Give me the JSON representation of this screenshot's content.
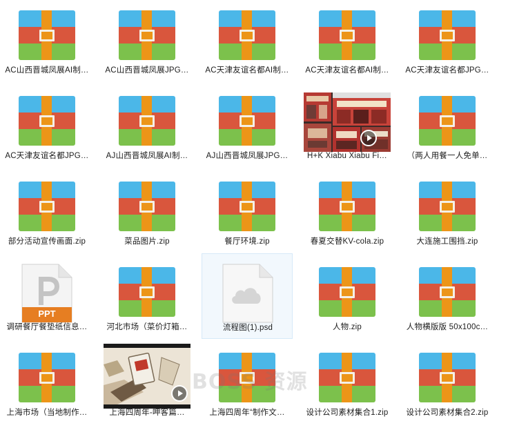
{
  "watermark": "BOSS 资源",
  "colors": {
    "zip_blue": "#4bb7e8",
    "zip_red": "#d9563d",
    "zip_green": "#7cc14c",
    "zip_strap": "#ec9518",
    "ppt_badge": "#e67e22",
    "selection": "#f2f8fd"
  },
  "files": [
    {
      "name": "AC山西晋城凤展AI制…",
      "icon": "zip-archive-icon"
    },
    {
      "name": "AC山西晋城凤展JPG…",
      "icon": "zip-archive-icon"
    },
    {
      "name": "AC天津友谊名都AI制…",
      "icon": "zip-archive-icon"
    },
    {
      "name": "AC天津友谊名都AI制…",
      "icon": "zip-archive-icon"
    },
    {
      "name": "AC天津友谊名都JPG…",
      "icon": "zip-archive-icon"
    },
    {
      "name": "AC天津友谊名都JPG…",
      "icon": "zip-archive-icon"
    },
    {
      "name": "AJ山西晋城凤展AI制…",
      "icon": "zip-archive-icon"
    },
    {
      "name": "AJ山西晋城凤展JPG…",
      "icon": "zip-archive-icon"
    },
    {
      "name": "H+K Xiabu Xiabu Fi…",
      "icon": "video-thumbnail-icon"
    },
    {
      "name": "（两人用餐一人免单…",
      "icon": "zip-archive-icon"
    },
    {
      "name": "部分活动宣传画面.zip",
      "icon": "zip-archive-icon"
    },
    {
      "name": "菜品图片.zip",
      "icon": "zip-archive-icon"
    },
    {
      "name": "餐厅环境.zip",
      "icon": "zip-archive-icon"
    },
    {
      "name": "春夏交替KV-cola.zip",
      "icon": "zip-archive-icon"
    },
    {
      "name": "大连施工围挡.zip",
      "icon": "zip-archive-icon"
    },
    {
      "name": "调研餐厅餐垫纸信息…",
      "icon": "ppt-file-icon",
      "badge": "PPT"
    },
    {
      "name": "河北市场（菜价灯箱…",
      "icon": "zip-archive-icon"
    },
    {
      "name": "流程图(1).psd",
      "icon": "cloud-file-icon"
    },
    {
      "name": "人物.zip",
      "icon": "zip-archive-icon"
    },
    {
      "name": "人物横版版 50x100c…",
      "icon": "zip-archive-icon"
    },
    {
      "name": "上海市场（当地制作…",
      "icon": "zip-archive-icon"
    },
    {
      "name": "上海四周年-呷客篇…",
      "icon": "video-thumbnail-icon"
    },
    {
      "name": "上海四周年“制作文…",
      "icon": "zip-archive-icon"
    },
    {
      "name": "设计公司素材集合1.zip",
      "icon": "zip-archive-icon"
    },
    {
      "name": "设计公司素材集合2.zip",
      "icon": "zip-archive-icon"
    }
  ]
}
